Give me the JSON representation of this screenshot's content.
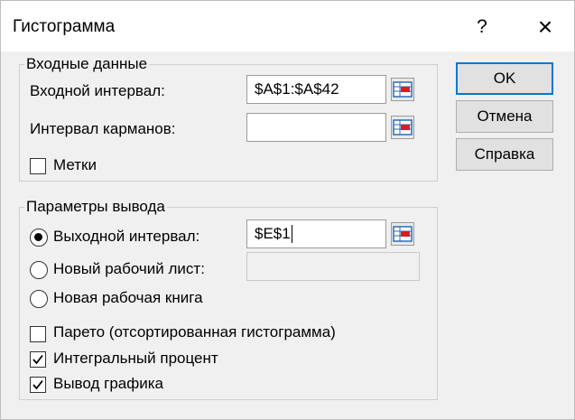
{
  "dialog": {
    "title": "Гистограмма",
    "help_label": "?",
    "close_label": "×"
  },
  "input_group": {
    "title": "Входные данные",
    "input_range_label": "Входной интервал:",
    "input_range_value": "$A$1:$A$42",
    "bin_range_label": "Интервал карманов:",
    "bin_range_value": "",
    "labels_label": "Метки",
    "labels_checked": false
  },
  "output_group": {
    "title": "Параметры вывода",
    "output_range_label": "Выходной интервал:",
    "output_range_value": "$E$1",
    "new_sheet_label": "Новый рабочий лист:",
    "new_sheet_value": "",
    "new_workbook_label": "Новая рабочая книга",
    "selected_option": "output_range",
    "pareto_label": "Парето (отсортированная гистограмма)",
    "pareto_checked": false,
    "cumulative_label": "Интегральный процент",
    "cumulative_checked": true,
    "chart_label": "Вывод графика",
    "chart_checked": true
  },
  "buttons": {
    "ok": "OK",
    "cancel": "Отмена",
    "help": "Справка"
  },
  "icons": {
    "collapse": "range-selector-icon",
    "check": "checkmark-icon"
  },
  "colors": {
    "default_button_border": "#0078d7",
    "collapse_icon_red": "#d42020",
    "collapse_icon_blue": "#2a6fb8"
  }
}
